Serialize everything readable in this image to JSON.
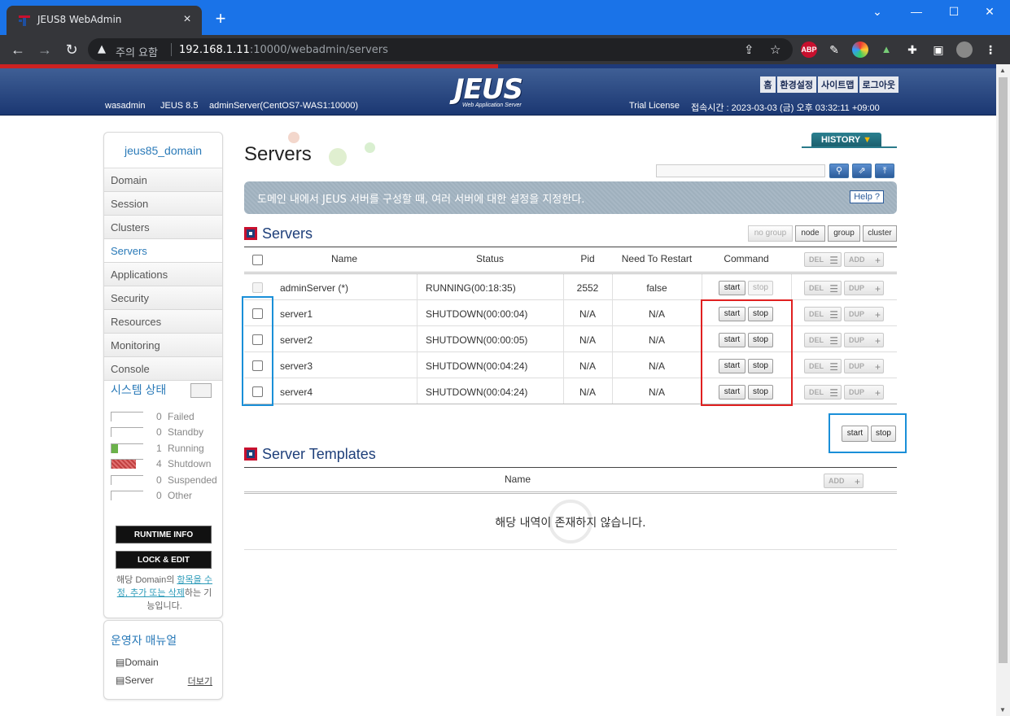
{
  "browser": {
    "tab_title": "JEUS8 WebAdmin",
    "security_warning": "주의 요함",
    "url_host": "192.168.1.11",
    "url_rest": ":10000/webadmin/servers",
    "ext_abp": "ABP"
  },
  "header": {
    "logo": "JEUS",
    "logo_sub": "Web Application Server",
    "links": [
      "홈",
      "환경설정",
      "사이트맵",
      "로그아웃"
    ],
    "user": "wasadmin",
    "version": "JEUS 8.5",
    "server": "adminServer(CentOS7-WAS1:10000)",
    "license": "Trial License",
    "access_time": "접속시간 : 2023-03-03 (금) 오후 03:32:11 +09:00"
  },
  "sidebar": {
    "domain_name": "jeus85_domain",
    "menu": [
      "Domain",
      "Session",
      "Clusters",
      "Servers",
      "Applications",
      "Security",
      "Resources",
      "Monitoring",
      "Console"
    ],
    "active": "Servers",
    "system_status_title": "시스템 상태",
    "status": [
      {
        "count": "0",
        "label": "Failed"
      },
      {
        "count": "0",
        "label": "Standby"
      },
      {
        "count": "1",
        "label": "Running"
      },
      {
        "count": "4",
        "label": "Shutdown"
      },
      {
        "count": "0",
        "label": "Suspended"
      },
      {
        "count": "0",
        "label": "Other"
      }
    ],
    "runtime_info": "RUNTIME INFO",
    "lock_edit": "LOCK & EDIT",
    "lock_desc_pre": "해당 Domain의 ",
    "lock_desc_link": "항목을 수정, 추가 또는 삭제",
    "lock_desc_post": "하는 기능입니다.",
    "manual_title": "운영자 매뉴얼",
    "manual_items": [
      "Domain",
      "Server"
    ],
    "more": "더보기"
  },
  "main": {
    "title": "Servers",
    "history": "HISTORY",
    "description": "도메인 내에서 JEUS 서버를 구성할 때, 여러 서버에 대한 설정을 지정한다.",
    "help": "Help",
    "servers_section": "Servers",
    "group_buttons": [
      "no group",
      "node",
      "group",
      "cluster"
    ],
    "columns": {
      "name": "Name",
      "status": "Status",
      "pid": "Pid",
      "restart": "Need To Restart",
      "command": "Command"
    },
    "del_label": "DEL",
    "add_label": "ADD",
    "dup_label": "DUP",
    "start_label": "start",
    "stop_label": "stop",
    "rows": [
      {
        "name": "adminServer (*)",
        "status": "RUNNING(00:18:35)",
        "pid": "2552",
        "restart": "false"
      },
      {
        "name": "server1",
        "status": "SHUTDOWN(00:00:04)",
        "pid": "N/A",
        "restart": "N/A"
      },
      {
        "name": "server2",
        "status": "SHUTDOWN(00:00:05)",
        "pid": "N/A",
        "restart": "N/A"
      },
      {
        "name": "server3",
        "status": "SHUTDOWN(00:04:24)",
        "pid": "N/A",
        "restart": "N/A"
      },
      {
        "name": "server4",
        "status": "SHUTDOWN(00:04:24)",
        "pid": "N/A",
        "restart": "N/A"
      }
    ],
    "templates_section": "Server Templates",
    "templates_col_name": "Name",
    "no_data": "해당 내역이 존재하지 않습니다."
  },
  "colors": {
    "accent_blue": "#2a7ab8",
    "highlight_blue": "#1a8fd8",
    "highlight_red": "#e02020",
    "header_navy": "#1b3772"
  }
}
